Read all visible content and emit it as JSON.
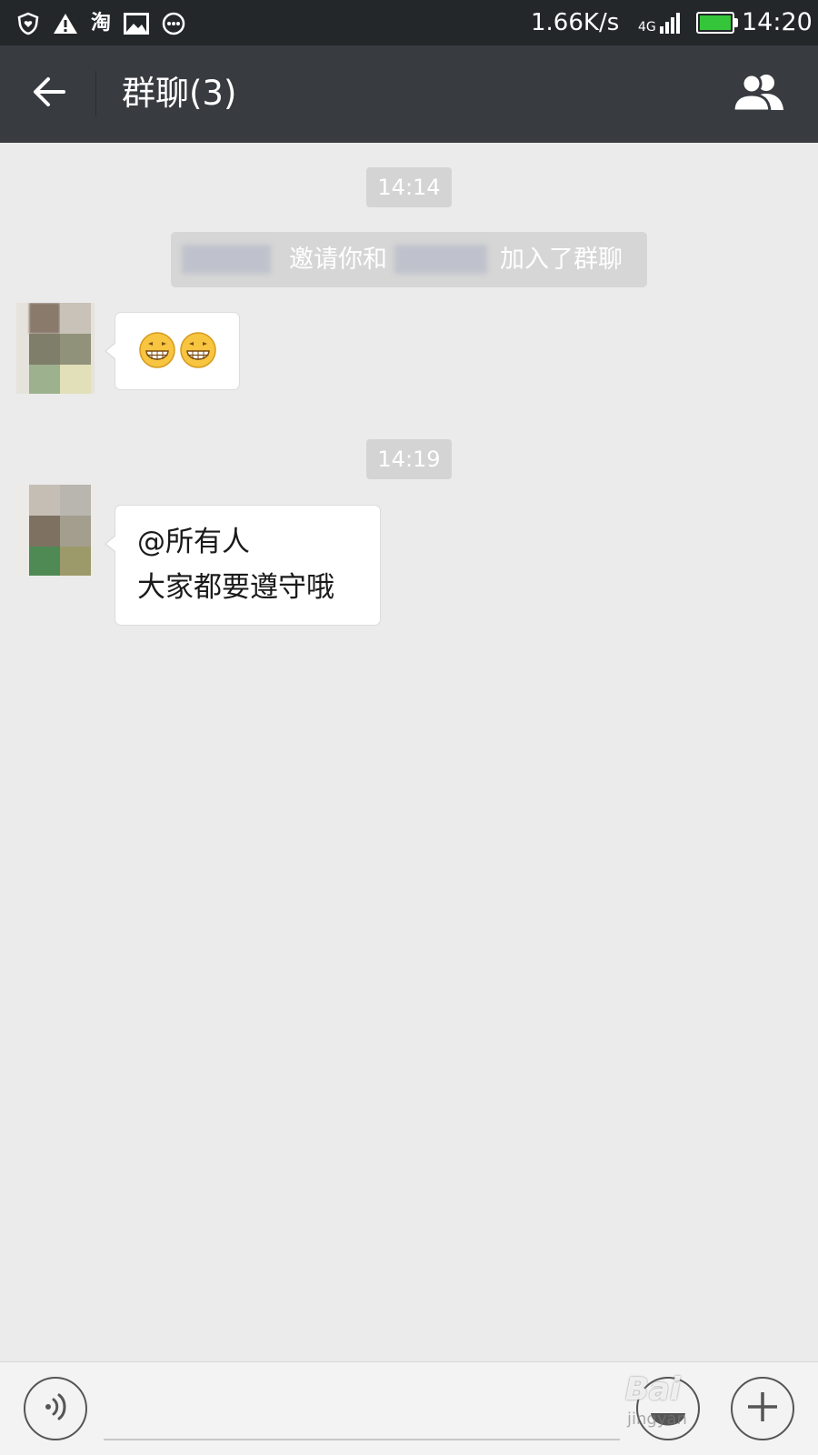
{
  "status_bar": {
    "carrier_app": "淘",
    "network_speed": "1.66K/s",
    "network_type": "4G",
    "time": "14:20",
    "battery_color": "#35c53a"
  },
  "header": {
    "title": "群聊(3)",
    "back_icon": "arrow-left-icon",
    "members_icon": "group-members-icon"
  },
  "chat": {
    "timestamps": [
      "14:14",
      "14:19"
    ],
    "system_message": {
      "invite_text": "邀请你和",
      "joined_text": "加入了群聊"
    },
    "messages": [
      {
        "type": "emoji",
        "emojis": [
          "grinning-face-icon",
          "grinning-face-icon"
        ]
      },
      {
        "type": "text",
        "lines": [
          "@所有人",
          "大家都要遵守哦"
        ]
      }
    ]
  },
  "input_bar": {
    "voice_icon": "voice-icon",
    "emoji_icon": "emoji-icon",
    "plus_icon": "plus-icon",
    "placeholder": ""
  },
  "watermark": {
    "text": "Bai",
    "sub": "jingyan"
  }
}
